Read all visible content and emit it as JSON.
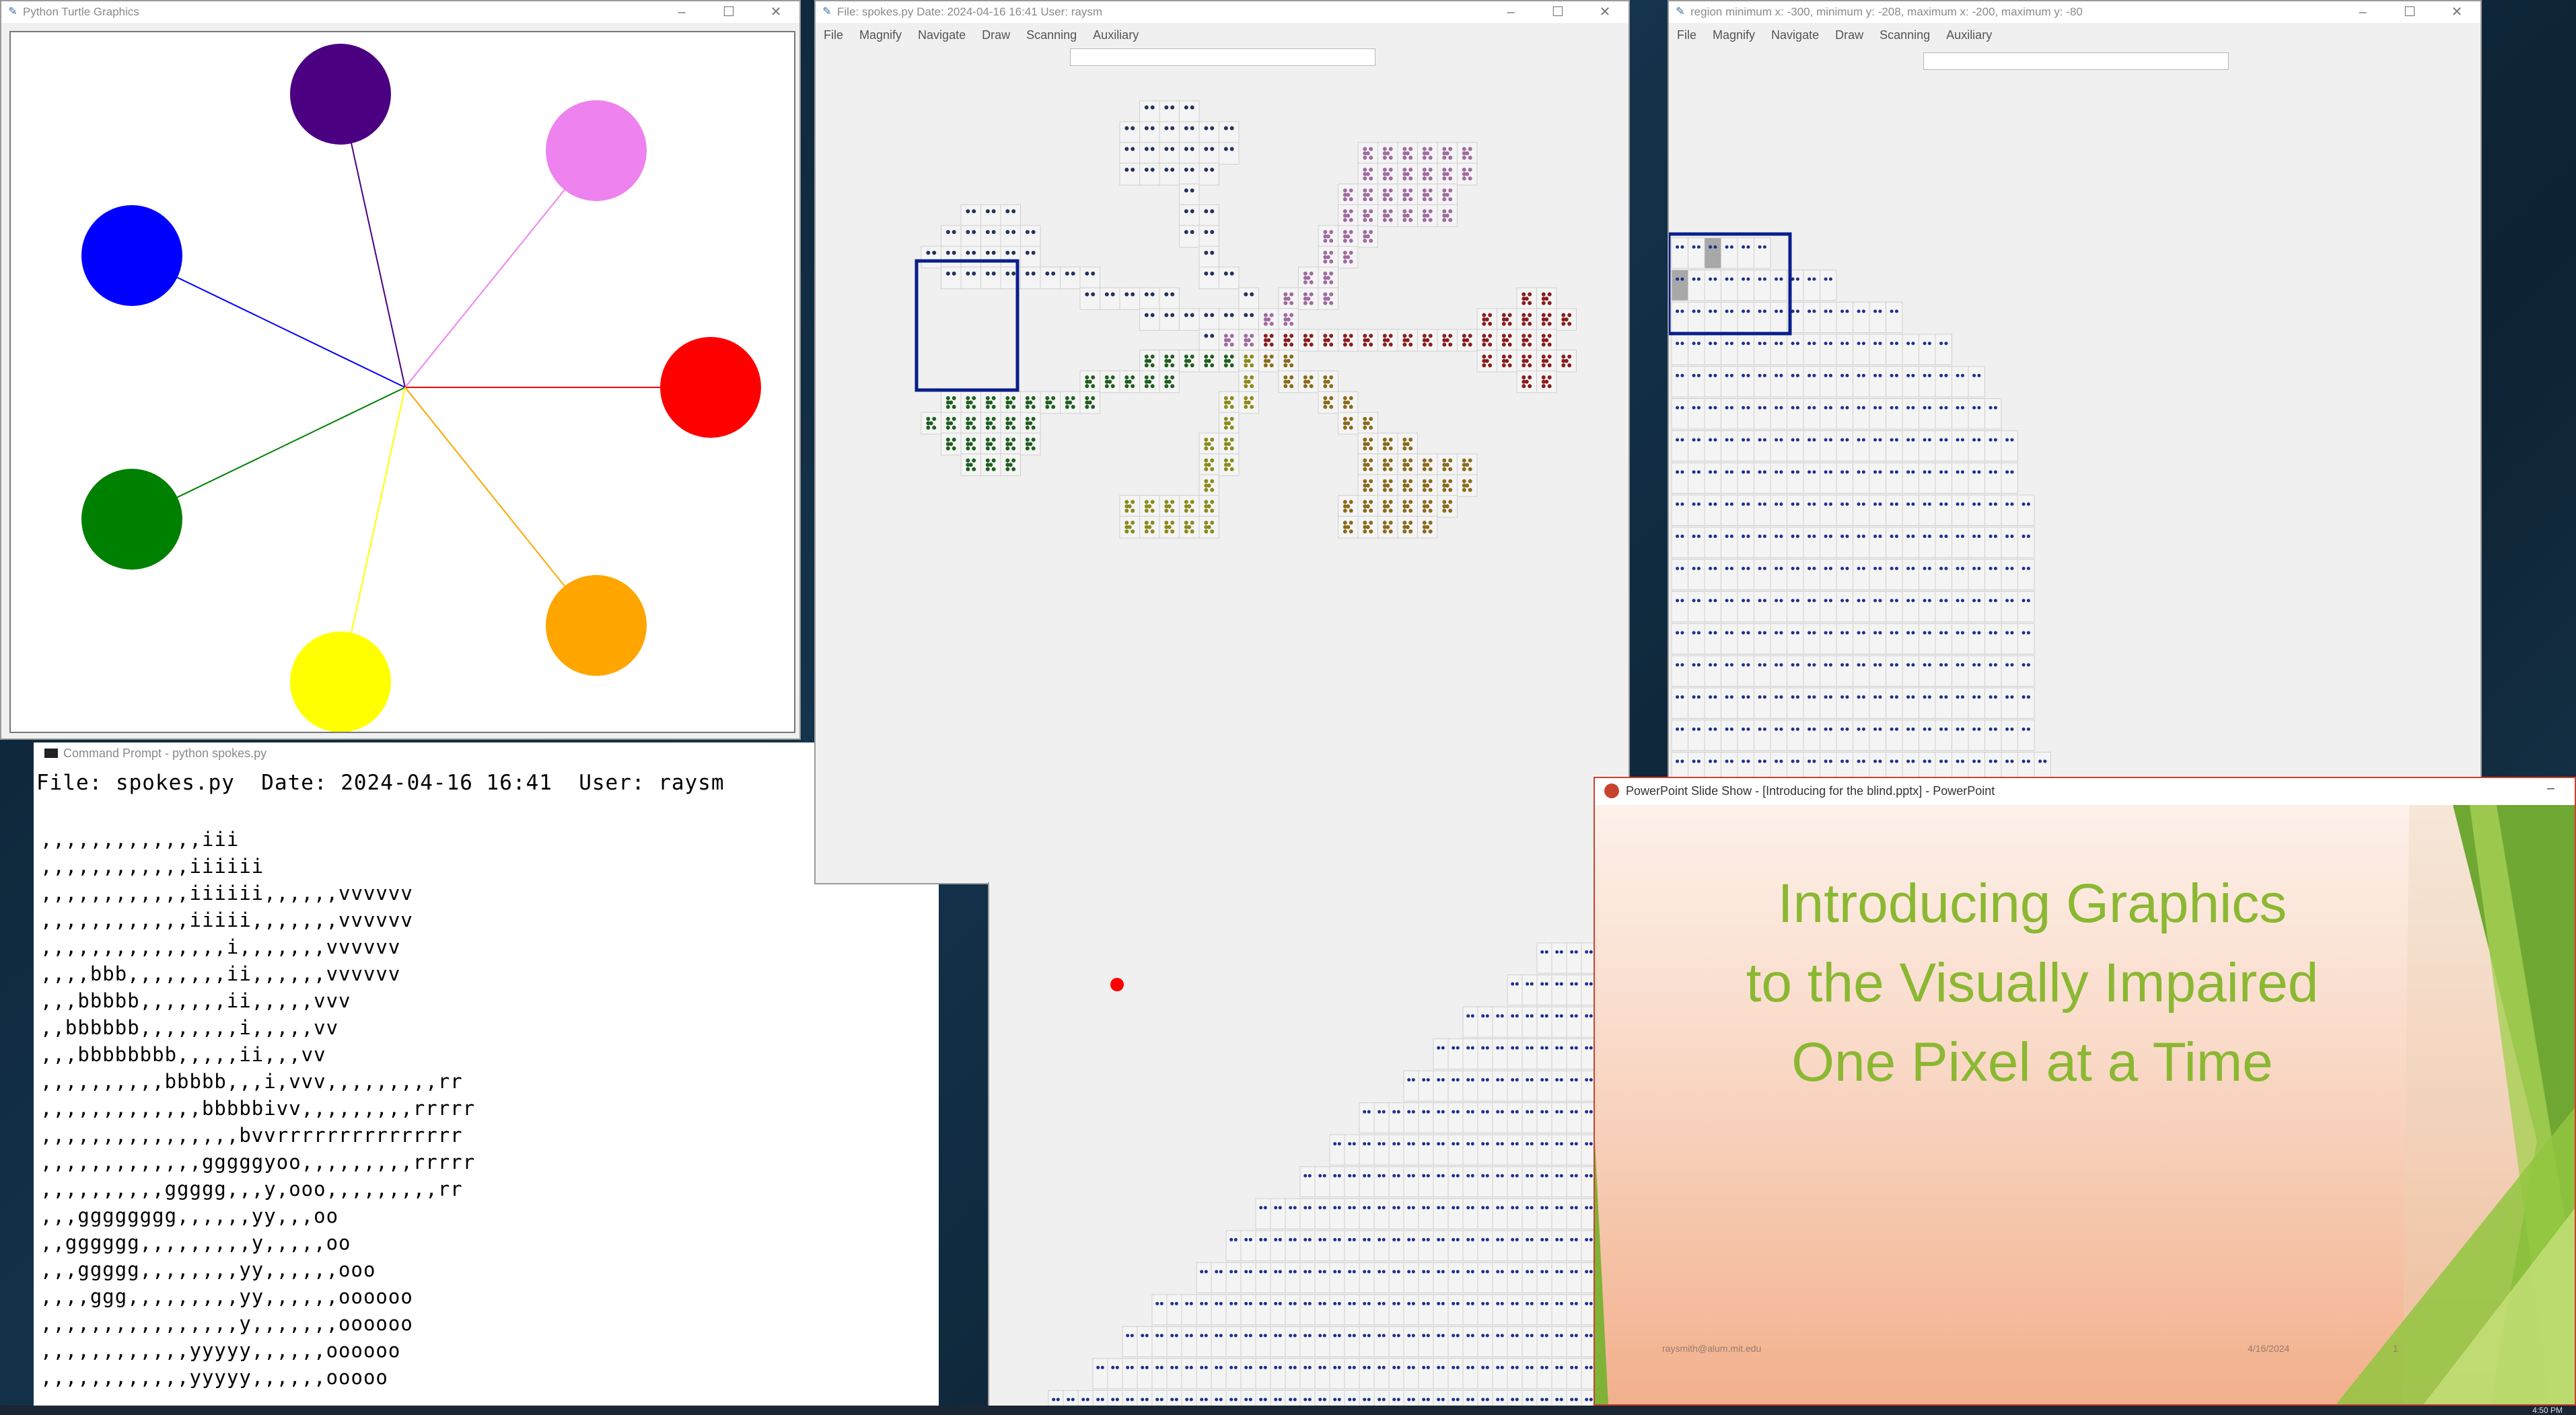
{
  "turtle_window": {
    "title": "Python Turtle Graphics"
  },
  "spokes_window": {
    "title": "File: spokes.py  Date: 2024-04-16 16:41  User: raysm",
    "menu": [
      "File",
      "Magnify",
      "Navigate",
      "Draw",
      "Scanning",
      "Auxiliary"
    ]
  },
  "region_window": {
    "title": "region minimum x: -300, minimum y: -208, maximum x: -200, maximum y: -80",
    "menu": [
      "File",
      "Magnify",
      "Navigate",
      "Draw",
      "Scanning",
      "Auxiliary"
    ]
  },
  "cmd_window": {
    "title": "Command Prompt - python  spokes.py",
    "header": "File: spokes.py  Date: 2024-04-16 16:41  User: raysm",
    "lines": [
      ",,,,,,,,,,,,,iii",
      ",,,,,,,,,,,,iiiiii",
      ",,,,,,,,,,,,iiiiii,,,,,,vvvvvv",
      ",,,,,,,,,,,,iiiii,,,,,,,vvvvvv",
      ",,,,,,,,,,,,,,,i,,,,,,,vvvvvv",
      ",,,,bbb,,,,,,,,ii,,,,,,vvvvvv",
      ",,,bbbbb,,,,,,,ii,,,,,vvv",
      ",,bbbbbb,,,,,,,,i,,,,,vv",
      ",,,bbbbbbbb,,,,,ii,,,vv",
      ",,,,,,,,,,bbbbb,,,i,vvv,,,,,,,,,rr",
      ",,,,,,,,,,,,,bbbbbivv,,,,,,,,,rrrrr",
      ",,,,,,,,,,,,,,,,bvvrrrrrrrrrrrrrrr",
      ",,,,,,,,,,,,,gggggyoo,,,,,,,,,rrrrr",
      ",,,,,,,,,,ggggg,,,y,ooo,,,,,,,,,rr",
      ",,,gggggggg,,,,,,yy,,,oo",
      ",,gggggg,,,,,,,,,y,,,,,oo",
      ",,,ggggg,,,,,,,,yy,,,,,,ooo",
      ",,,,ggg,,,,,,,,,yy,,,,,,oooooo",
      ",,,,,,,,,,,,,,,,y,,,,,,,oooooo",
      ",,,,,,,,,,,,yyyyy,,,,,,oooooo",
      ",,,,,,,,,,,,yyyyy,,,,,,ooooo"
    ]
  },
  "ppt_window": {
    "title": "PowerPoint Slide Show - [Introducing for the blind.pptx] - PowerPoint",
    "slide_line1": "Introducing Graphics",
    "slide_line2": "to the Visually Impaired",
    "slide_line3": "One Pixel at a Time",
    "footer_email": "raysmith@alum.mit.edu",
    "footer_date": "4/16/2024",
    "footer_page": "1"
  },
  "taskbar": {
    "clock": "4:50 PM"
  },
  "colors": {
    "purple": "#4b0082",
    "violet": "#ee82ee",
    "blue": "#0000ff",
    "red": "#ff0000",
    "green": "#008000",
    "orange": "#ffa500",
    "yellow": "#ffff00",
    "slide_green": "#8bb832",
    "dot_blue": "#1e2f8f",
    "highlight_blue": "#0a1e8c"
  }
}
